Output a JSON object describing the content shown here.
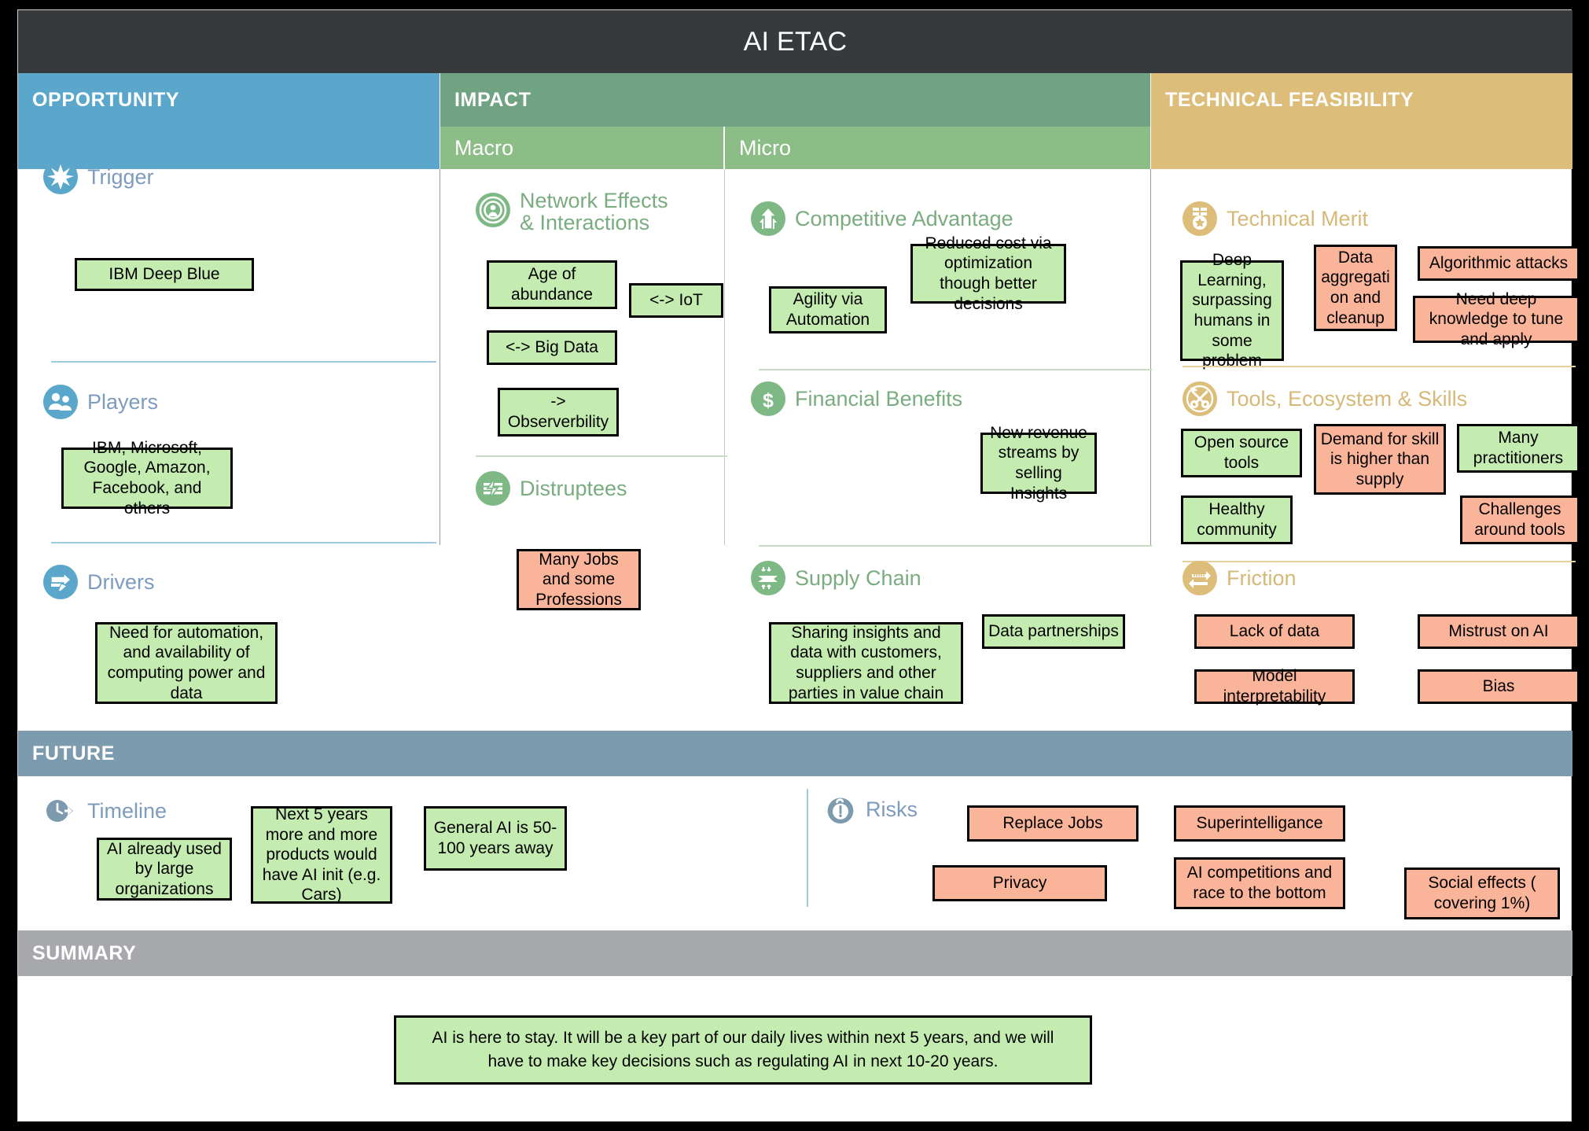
{
  "title": "AI ETAC",
  "colors": {
    "titlebar": "#373a3c",
    "opportunity": "#5ba7cc",
    "impact": "#6fa382",
    "impact_sub": "#8cbd86",
    "technical": "#dcbd79",
    "future": "#7d9bae",
    "summary": "#a6a8ab",
    "green_note": "#c5ecb0",
    "red_note": "#f9b49a"
  },
  "columns": {
    "opportunity": {
      "label": "OPPORTUNITY"
    },
    "impact": {
      "label": "IMPACT",
      "sub_macro": "Macro",
      "sub_micro": "Micro"
    },
    "technical": {
      "label": "TECHNICAL FEASIBILITY"
    }
  },
  "opportunity_sections": [
    {
      "icon": "star-burst-icon",
      "title": "Trigger",
      "notes": [
        {
          "text": "IBM Deep Blue",
          "tone": "green"
        }
      ]
    },
    {
      "icon": "people-group-icon",
      "title": "Players",
      "notes": [
        {
          "text": "IBM, Microsoft, Google, Amazon, Facebook, and others",
          "tone": "green"
        }
      ]
    },
    {
      "icon": "arrow-pen-icon",
      "title": "Drivers",
      "notes": [
        {
          "text": "Need for automation, and availability of computing power and data",
          "tone": "green"
        }
      ]
    }
  ],
  "macro_sections": [
    {
      "icon": "network-target-icon",
      "title": "Network Effects\n& Interactions",
      "notes": [
        {
          "text": "Age of abundance",
          "tone": "green"
        },
        {
          "text": "<-> IoT",
          "tone": "green"
        },
        {
          "text": "<-> Big Data",
          "tone": "green"
        },
        {
          "text": "-> Observerbility",
          "tone": "green"
        }
      ]
    },
    {
      "icon": "disruption-bolt-icon",
      "title": "Distruptees",
      "notes": [
        {
          "text": "Many Jobs and some Professions",
          "tone": "red"
        }
      ]
    }
  ],
  "micro_sections": [
    {
      "icon": "up-arrow-icon",
      "title": "Competitive Advantage",
      "notes": [
        {
          "text": "Agility via Automation",
          "tone": "green"
        },
        {
          "text": "Reduced cost via optimization though better decisions",
          "tone": "green"
        }
      ]
    },
    {
      "icon": "dollar-icon",
      "title": "Financial Benefits",
      "notes": [
        {
          "text": "New revenue streams by selling Insights",
          "tone": "green"
        }
      ]
    },
    {
      "icon": "supply-chain-icon",
      "title": "Supply Chain",
      "notes": [
        {
          "text": "Sharing insights and data with customers, suppliers and other parties in value chain",
          "tone": "green"
        },
        {
          "text": "Data partnerships",
          "tone": "green"
        }
      ]
    }
  ],
  "technical_sections": [
    {
      "icon": "medal-icon",
      "title": "Technical Merit",
      "notes": [
        {
          "text": "Deep Learning, surpassing humans in some problem",
          "tone": "green"
        },
        {
          "text": "Data aggregati on and cleanup",
          "tone": "red"
        },
        {
          "text": "Algorithmic attacks",
          "tone": "red"
        },
        {
          "text": "Need deep knowledge to tune and apply",
          "tone": "red"
        }
      ]
    },
    {
      "icon": "tools-icon",
      "title": "Tools, Ecosystem & Skills",
      "notes": [
        {
          "text": "Open source tools",
          "tone": "green"
        },
        {
          "text": "Demand for skill is higher than supply",
          "tone": "red"
        },
        {
          "text": "Many practitioners",
          "tone": "green"
        },
        {
          "text": "Healthy community",
          "tone": "green"
        },
        {
          "text": "Challenges around tools",
          "tone": "red"
        }
      ]
    },
    {
      "icon": "friction-icon",
      "title": "Friction",
      "notes": [
        {
          "text": "Lack of data",
          "tone": "red"
        },
        {
          "text": "Mistrust on AI",
          "tone": "red"
        },
        {
          "text": "Model interpretability",
          "tone": "red"
        },
        {
          "text": "Bias",
          "tone": "red"
        }
      ]
    }
  ],
  "future": {
    "label": "FUTURE",
    "timeline": {
      "icon": "clock-arrow-icon",
      "title": "Timeline",
      "notes": [
        {
          "text": "AI already used by large organizations",
          "tone": "green"
        },
        {
          "text": "Next 5 years more and more products would have AI init (e.g. Cars)",
          "tone": "green"
        },
        {
          "text": "General AI is 50-100 years away",
          "tone": "green"
        }
      ]
    },
    "risks": {
      "icon": "risk-alert-icon",
      "title": "Risks",
      "notes": [
        {
          "text": "Replace Jobs",
          "tone": "red"
        },
        {
          "text": "Superintelligance",
          "tone": "red"
        },
        {
          "text": "Privacy",
          "tone": "red"
        },
        {
          "text": "AI competitions and race to the bottom",
          "tone": "red"
        },
        {
          "text": "Social effects ( covering 1%)",
          "tone": "red"
        }
      ]
    }
  },
  "summary": {
    "label": "SUMMARY",
    "text": "AI is here to stay. It will be a key part of our daily lives within next 5 years, and we will have to make key decisions such as regulating AI in next 10-20 years."
  }
}
